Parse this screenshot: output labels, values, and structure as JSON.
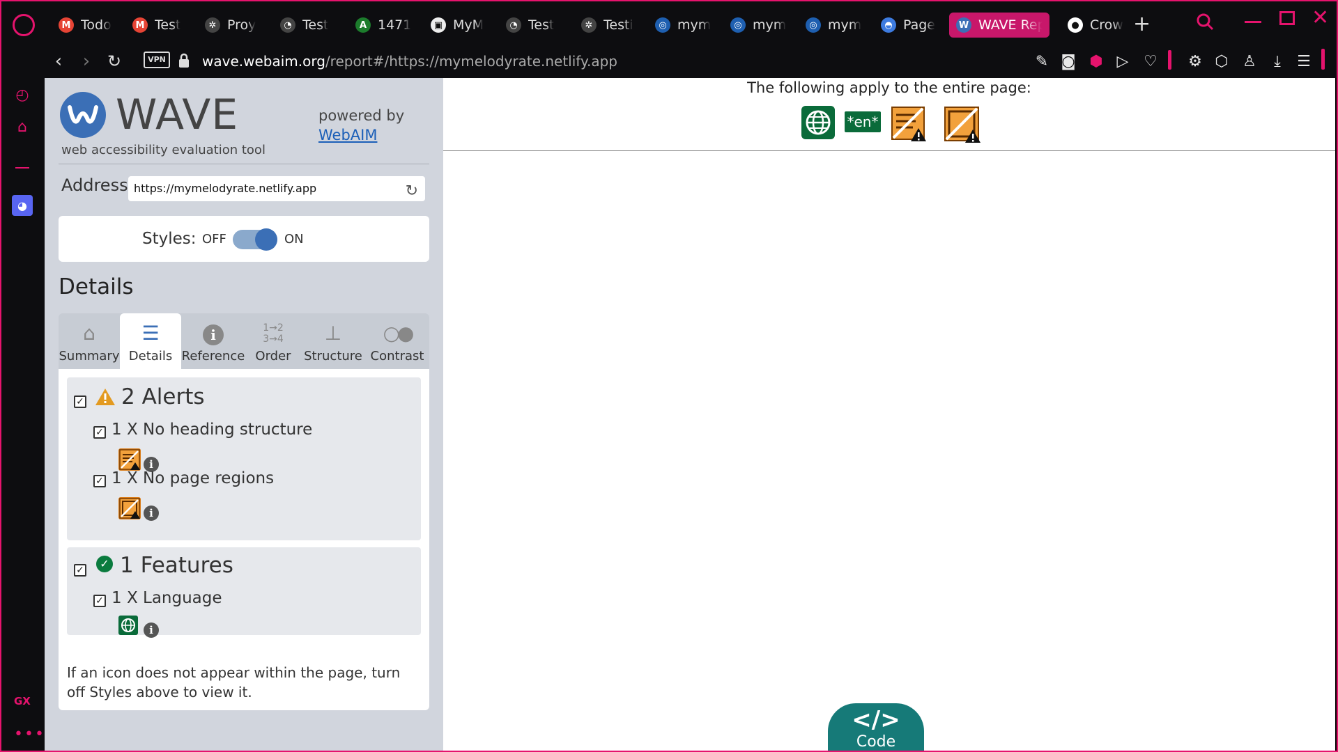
{
  "browser": {
    "tabs": [
      {
        "label": "Todo",
        "icon": "gmail-icon",
        "color": "#e64435",
        "glyph": "M"
      },
      {
        "label": "Test",
        "icon": "gmail-icon",
        "color": "#e64435",
        "glyph": "M"
      },
      {
        "label": "Proy",
        "icon": "openai-icon",
        "color": "#444",
        "glyph": "✲"
      },
      {
        "label": "Test",
        "icon": "pipeline-icon",
        "color": "#444",
        "glyph": "◔"
      },
      {
        "label": "1471",
        "icon": "app-icon",
        "color": "#1c7c2c",
        "glyph": "A"
      },
      {
        "label": "MyM",
        "icon": "page-icon",
        "color": "#eee",
        "glyph": "▣"
      },
      {
        "label": "Test",
        "icon": "pipeline-icon",
        "color": "#444",
        "glyph": "◔"
      },
      {
        "label": "Testi",
        "icon": "openai-icon",
        "color": "#444",
        "glyph": "✲"
      },
      {
        "label": "mym",
        "icon": "netlify-icon",
        "color": "#1e5fb0",
        "glyph": "◎"
      },
      {
        "label": "mym",
        "icon": "netlify-icon",
        "color": "#1e5fb0",
        "glyph": "◎"
      },
      {
        "label": "mym",
        "icon": "netlify-icon",
        "color": "#1e5fb0",
        "glyph": "◎"
      },
      {
        "label": "Page",
        "icon": "pagespeed-icon",
        "color": "#3d7be0",
        "glyph": "◓"
      },
      {
        "label": "WAVE Rep",
        "icon": "wave-icon",
        "color": "#3b6fb6",
        "glyph": "W"
      },
      {
        "label": "Crow",
        "icon": "github-icon",
        "color": "#fff",
        "glyph": "●"
      }
    ],
    "url_host": "wave.webaim.org",
    "url_rest": "/report#/https://mymelodyrate.netlify.app",
    "vpn": "VPN"
  },
  "wave": {
    "logo_text": "WAVE",
    "logo_sub": "web accessibility evaluation tool",
    "powered_by": "powered by",
    "webaim": "WebAIM",
    "address_label": "Address:",
    "address_value": "https://mymelodyrate.netlify.app",
    "styles_label": "Styles:",
    "styles_off": "OFF",
    "styles_on": "ON",
    "details_heading": "Details",
    "tabs": [
      {
        "label": "Summary",
        "icon": "home-icon"
      },
      {
        "label": "Details",
        "icon": "list-icon"
      },
      {
        "label": "Reference",
        "icon": "info-icon"
      },
      {
        "label": "Order",
        "icon": "order-icon"
      },
      {
        "label": "Structure",
        "icon": "structure-icon"
      },
      {
        "label": "Contrast",
        "icon": "contrast-icon"
      }
    ],
    "alerts_heading": "2 Alerts",
    "alert_items": [
      "1 X No heading structure",
      "1 X No page regions"
    ],
    "features_heading": "1 Features",
    "feature_items": [
      "1 X Language"
    ],
    "note": "If an icon does not appear within the page, turn off Styles above to view it."
  },
  "main": {
    "entire_label": "The following apply to the entire page:",
    "lang_badge": "*en*",
    "code_label": "Code",
    "code_glyph": "</>"
  },
  "colors": {
    "accent": "#e5136d",
    "wave_blue": "#3b6fb6",
    "feature_green": "#0a6b3a",
    "alert_orange": "#d97b17",
    "code_teal": "#167a78"
  }
}
